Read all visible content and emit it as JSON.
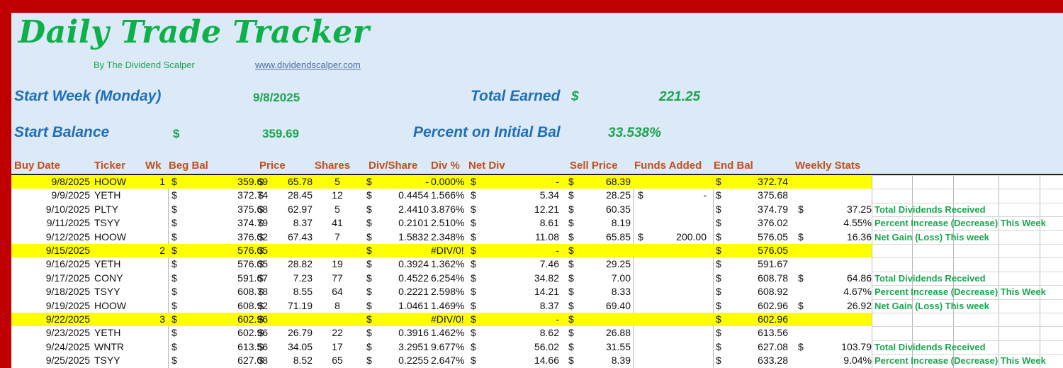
{
  "title": "Daily Trade Tracker",
  "byline": "By The Dividend Scalper",
  "website": "www.dividendscalper.com",
  "summary": {
    "start_week_label": "Start  Week (Monday)",
    "start_week_value": "9/8/2025",
    "total_earned_label": "Total Earned",
    "total_earned_currency": "$",
    "total_earned_value": "221.25",
    "start_balance_label": "Start Balance",
    "start_balance_currency": "$",
    "start_balance_value": "359.69",
    "percent_label": "Percent on Initial Bal",
    "percent_value": "33.538%"
  },
  "columns": [
    "Buy Date",
    "Ticker",
    "Wk",
    "Beg Bal",
    "Price",
    "Shares",
    "Div/Share",
    "Div %",
    "Net Div",
    "Sell Price",
    "Funds Added",
    "End Bal",
    "Weekly Stats"
  ],
  "rows": [
    {
      "date": "9/8/2025",
      "ticker": "HOOW",
      "wk": "1",
      "beg": "359.69",
      "price": "65.78",
      "shares": "5",
      "divsh": "-",
      "divpct": "0.000%",
      "netdiv": "-",
      "sell": "68.39",
      "funds_cur": "",
      "funds": "",
      "end": "372.74",
      "stat_cur": "",
      "stat_val": "",
      "stat_label": "",
      "yellow": true
    },
    {
      "date": "9/9/2025",
      "ticker": "YETH",
      "wk": "",
      "beg": "372.74",
      "price": "28.45",
      "shares": "12",
      "divsh": "0.4454",
      "divpct": "1.566%",
      "netdiv": "5.34",
      "sell": "28.25",
      "funds_cur": "$",
      "funds": "-",
      "end": "375.68",
      "stat_cur": "",
      "stat_val": "",
      "stat_label": "",
      "yellow": false
    },
    {
      "date": "9/10/2025",
      "ticker": "PLTY",
      "wk": "",
      "beg": "375.68",
      "price": "62.97",
      "shares": "5",
      "divsh": "2.4410",
      "divpct": "3.876%",
      "netdiv": "12.21",
      "sell": "60.35",
      "funds_cur": "",
      "funds": "",
      "end": "374.79",
      "stat_cur": "$",
      "stat_val": "37.25",
      "stat_label": "Total Dividends Received",
      "yellow": false
    },
    {
      "date": "9/11/2025",
      "ticker": "TSYY",
      "wk": "",
      "beg": "374.79",
      "price": "8.37",
      "shares": "41",
      "divsh": "0.2101",
      "divpct": "2.510%",
      "netdiv": "8.61",
      "sell": "8.19",
      "funds_cur": "",
      "funds": "",
      "end": "376.02",
      "stat_cur": "",
      "stat_val": "4.55%",
      "stat_label": "Percent Increase (Decrease) This Week",
      "yellow": false
    },
    {
      "date": "9/12/2025",
      "ticker": "HOOW",
      "wk": "",
      "beg": "376.02",
      "price": "67.43",
      "shares": "7",
      "divsh": "1.5832",
      "divpct": "2.348%",
      "netdiv": "11.08",
      "sell": "65.85",
      "funds_cur": "$",
      "funds": "200.00",
      "end": "576.05",
      "stat_cur": "$",
      "stat_val": "16.36",
      "stat_label": "Net Gain (Loss) This week",
      "yellow": false
    },
    {
      "date": "9/15/2025",
      "ticker": "",
      "wk": "2",
      "beg": "576.05",
      "price": "",
      "shares": "",
      "divsh": "",
      "divpct": "#DIV/0!",
      "netdiv": "-",
      "sell": "",
      "funds_cur": "",
      "funds": "",
      "end": "576.05",
      "stat_cur": "",
      "stat_val": "",
      "stat_label": "",
      "yellow": true
    },
    {
      "date": "9/16/2025",
      "ticker": "YETH",
      "wk": "",
      "beg": "576.05",
      "price": "28.82",
      "shares": "19",
      "divsh": "0.3924",
      "divpct": "1.362%",
      "netdiv": "7.46",
      "sell": "29.25",
      "funds_cur": "",
      "funds": "",
      "end": "591.67",
      "stat_cur": "",
      "stat_val": "",
      "stat_label": "",
      "yellow": false
    },
    {
      "date": "9/17/2025",
      "ticker": "CONY",
      "wk": "",
      "beg": "591.67",
      "price": "7.23",
      "shares": "77",
      "divsh": "0.4522",
      "divpct": "6.254%",
      "netdiv": "34.82",
      "sell": "7.00",
      "funds_cur": "",
      "funds": "",
      "end": "608.78",
      "stat_cur": "$",
      "stat_val": "64.86",
      "stat_label": "Total Dividends Received",
      "yellow": false
    },
    {
      "date": "9/18/2025",
      "ticker": "TSYY",
      "wk": "",
      "beg": "608.78",
      "price": "8.55",
      "shares": "64",
      "divsh": "0.2221",
      "divpct": "2.598%",
      "netdiv": "14.21",
      "sell": "8.33",
      "funds_cur": "",
      "funds": "",
      "end": "608.92",
      "stat_cur": "",
      "stat_val": "4.67%",
      "stat_label": "Percent Increase (Decrease) This Week",
      "yellow": false
    },
    {
      "date": "9/19/2025",
      "ticker": "HOOW",
      "wk": "",
      "beg": "608.92",
      "price": "71.19",
      "shares": "8",
      "divsh": "1.0461",
      "divpct": "1.469%",
      "netdiv": "8.37",
      "sell": "69.40",
      "funds_cur": "",
      "funds": "",
      "end": "602.96",
      "stat_cur": "$",
      "stat_val": "26.92",
      "stat_label": "Net Gain (Loss) This week",
      "yellow": false
    },
    {
      "date": "9/22/2025",
      "ticker": "",
      "wk": "3",
      "beg": "602.96",
      "price": "",
      "shares": "",
      "divsh": "",
      "divpct": "#DIV/0!",
      "netdiv": "-",
      "sell": "",
      "funds_cur": "",
      "funds": "",
      "end": "602.96",
      "stat_cur": "",
      "stat_val": "",
      "stat_label": "",
      "yellow": true
    },
    {
      "date": "9/23/2025",
      "ticker": "YETH",
      "wk": "",
      "beg": "602.96",
      "price": "26.79",
      "shares": "22",
      "divsh": "0.3916",
      "divpct": "1.462%",
      "netdiv": "8.62",
      "sell": "26.88",
      "funds_cur": "",
      "funds": "",
      "end": "613.56",
      "stat_cur": "",
      "stat_val": "",
      "stat_label": "",
      "yellow": false
    },
    {
      "date": "9/24/2025",
      "ticker": "WNTR",
      "wk": "",
      "beg": "613.56",
      "price": "34.05",
      "shares": "17",
      "divsh": "3.2951",
      "divpct": "9.677%",
      "netdiv": "56.02",
      "sell": "31.55",
      "funds_cur": "",
      "funds": "",
      "end": "627.08",
      "stat_cur": "$",
      "stat_val": "103.79",
      "stat_label": "Total Dividends Received",
      "yellow": false
    },
    {
      "date": "9/25/2025",
      "ticker": "TSYY",
      "wk": "",
      "beg": "627.08",
      "price": "8.52",
      "shares": "65",
      "divsh": "0.2255",
      "divpct": "2.647%",
      "netdiv": "14.66",
      "sell": "8.39",
      "funds_cur": "",
      "funds": "",
      "end": "633.28",
      "stat_cur": "",
      "stat_val": "9.04%",
      "stat_label": "Percent Increase (Decrease) This Week",
      "yellow": false
    }
  ]
}
